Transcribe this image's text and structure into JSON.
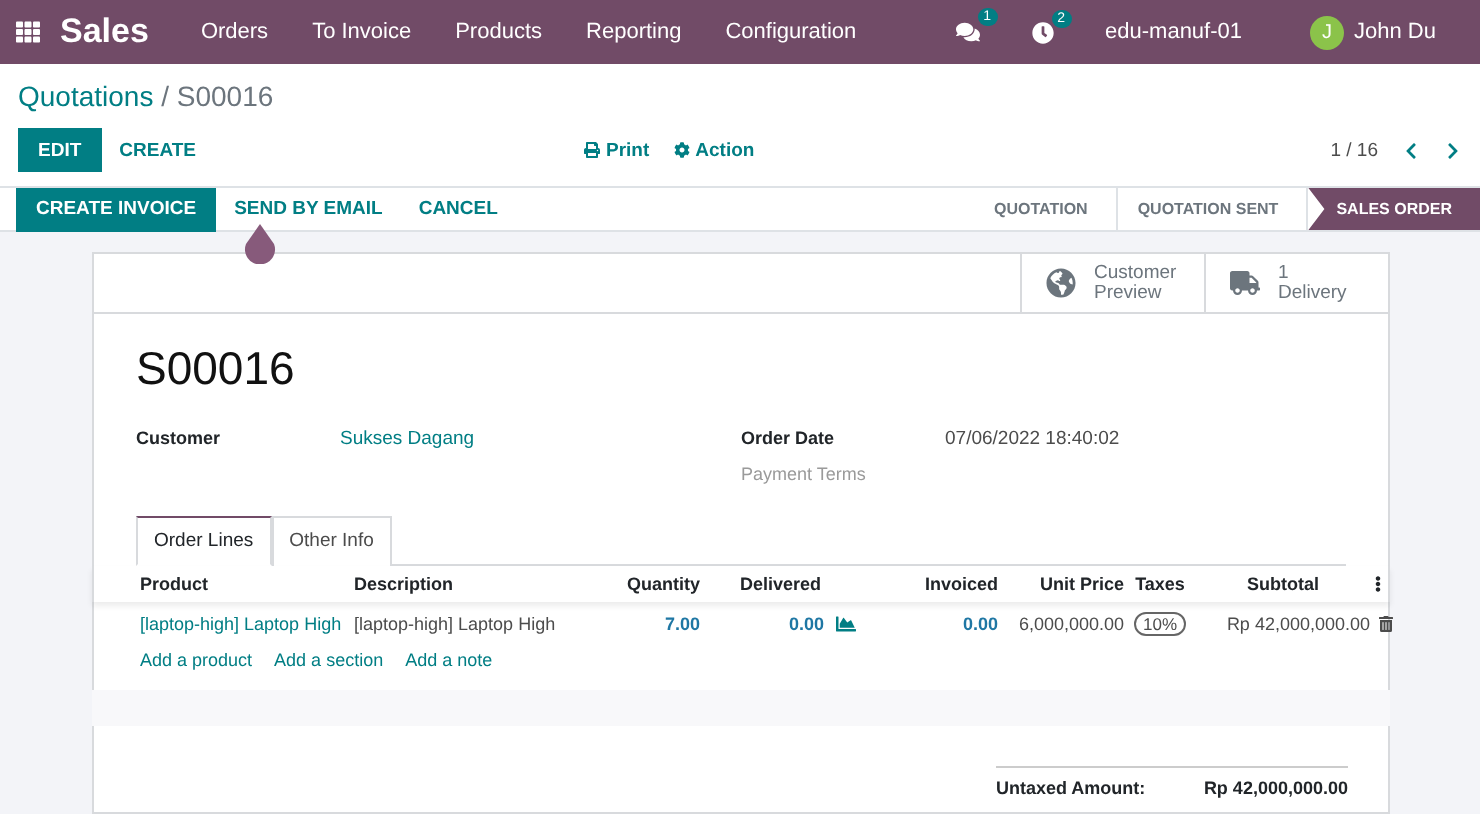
{
  "navbar": {
    "app": "Sales",
    "menu": [
      "Orders",
      "To Invoice",
      "Products",
      "Reporting",
      "Configuration"
    ],
    "messages_badge": "1",
    "activities_badge": "2",
    "company": "edu-manuf-01",
    "user_initial": "J",
    "user_name": "John Du"
  },
  "breadcrumb": {
    "parent": "Quotations",
    "separator": "/",
    "current": "S00016"
  },
  "control_panel": {
    "buttons": [
      {
        "label": "EDIT",
        "kind": "primary"
      },
      {
        "label": "CREATE",
        "kind": "link"
      }
    ],
    "print": "Print",
    "action": "Action",
    "pager": "1 / 16"
  },
  "status_bar": {
    "buttons": [
      {
        "label": "CREATE INVOICE",
        "kind": "primary"
      },
      {
        "label": "SEND BY EMAIL",
        "kind": "link"
      },
      {
        "label": "CANCEL",
        "kind": "link"
      }
    ],
    "stages": [
      {
        "label": "QUOTATION",
        "selected": false
      },
      {
        "label": "QUOTATION SENT",
        "selected": false
      },
      {
        "label": "SALES ORDER",
        "selected": true
      }
    ]
  },
  "smart_buttons": [
    {
      "kind": "globe",
      "line1": "Customer",
      "line2": "Preview"
    },
    {
      "kind": "truck",
      "line1": "1",
      "line2": "Delivery"
    }
  ],
  "title": "S00016",
  "fields_left": [
    {
      "label": "Customer",
      "value": "Sukses Dagang"
    }
  ],
  "fields_right": [
    {
      "label": "Order Date",
      "value": "07/06/2022 18:40:02"
    },
    {
      "label": "Payment Terms"
    }
  ],
  "tabs": [
    {
      "label": "Order Lines",
      "selected": true
    },
    {
      "label": "Other Info",
      "selected": false
    }
  ],
  "table": {
    "columns": [
      "Product",
      "Description",
      "Quantity",
      "Delivered",
      "Invoiced",
      "Unit Price",
      "Taxes",
      "Subtotal"
    ],
    "rows": [
      {
        "product": "[laptop-high] Laptop High",
        "description": "[laptop-high] Laptop High",
        "quantity": "7.00",
        "delivered": "0.00",
        "invoiced": "0.00",
        "unit_price": "6,000,000.00",
        "tax": "10%",
        "subtotal": "Rp 42,000,000.00"
      }
    ],
    "add_links": [
      "Add a product",
      "Add a section",
      "Add a note"
    ]
  },
  "totals": [
    {
      "label": "Untaxed Amount:",
      "value": "Rp 42,000,000.00"
    }
  ]
}
